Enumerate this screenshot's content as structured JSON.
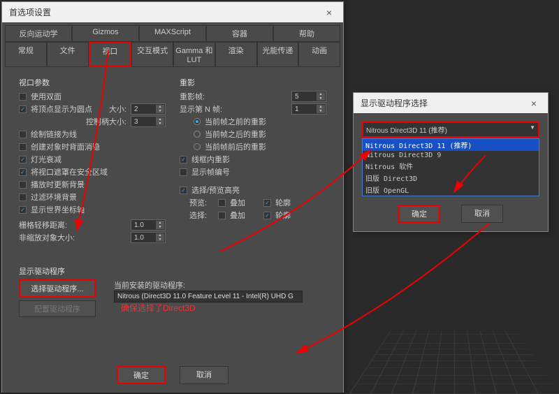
{
  "main": {
    "title": "首选项设置",
    "tabs_row1": [
      "反向运动学",
      "Gizmos",
      "MAXScript",
      "容器",
      "帮助"
    ],
    "tabs_row2": [
      "常规",
      "文件",
      "视口",
      "交互模式",
      "Gamma 和 LUT",
      "渲染",
      "光能传递",
      "动画"
    ],
    "active_tab": "视口",
    "viewport_params": {
      "title": "视口参数",
      "use_double": "使用双面",
      "vertex_dot": "将顶点显示为圆点",
      "size_label": "大小:",
      "size_val": "2",
      "handle_size": "控制柄大小:",
      "handle_val": "3",
      "draw_links": "绘制链接为线",
      "backface": "创建对象时背面消隐",
      "light_atten": "灯光衰减",
      "safe_region": "将视口遮罩在安全区域",
      "update_bg": "播放时更新背景",
      "filter_bg": "过滤环境背景",
      "world_axis": "显示世界坐标轴",
      "grid_dist": "栅格轻移距离:",
      "grid_val": "1.0",
      "nonscale": "非缩放对象大小:",
      "nonscale_val": "1.0"
    },
    "ghosting": {
      "title": "重影",
      "frames": "重影帧:",
      "frames_val": "5",
      "nth": "显示第 N 帧:",
      "nth_val": "1",
      "before": "当前帧之前的重影",
      "after": "当前帧之后的重影",
      "both": "当前帧前后的重影",
      "wireframe": "线框内重影",
      "frame_num": "显示帧编号"
    },
    "sel_preview": {
      "title": "选择/预览高亮",
      "preview": "预览:",
      "select": "选择:",
      "overlay": "叠加",
      "outline": "轮廓"
    },
    "driver": {
      "title": "显示驱动程序",
      "choose_btn": "选择驱动程序...",
      "config_btn": "配置驱动程序",
      "current_label": "当前安装的驱动程序:",
      "current_val": "Nitrous (Direct3D 11.0 Feature Level 11 - Intel(R) UHD G"
    },
    "note": "确保选择了Direct3D",
    "ok": "确定",
    "cancel": "取消"
  },
  "driver_dialog": {
    "title": "显示驱动程序选择",
    "dropdown": "Nitrous Direct3D 11 (推荐)",
    "options": [
      "Nitrous Direct3D 11 (推荐)",
      "Nitrous Direct3D 9",
      "Nitrous 软件",
      "旧版 Direct3D",
      "旧版 OpenGL"
    ],
    "ok": "确定",
    "cancel": "取消"
  }
}
